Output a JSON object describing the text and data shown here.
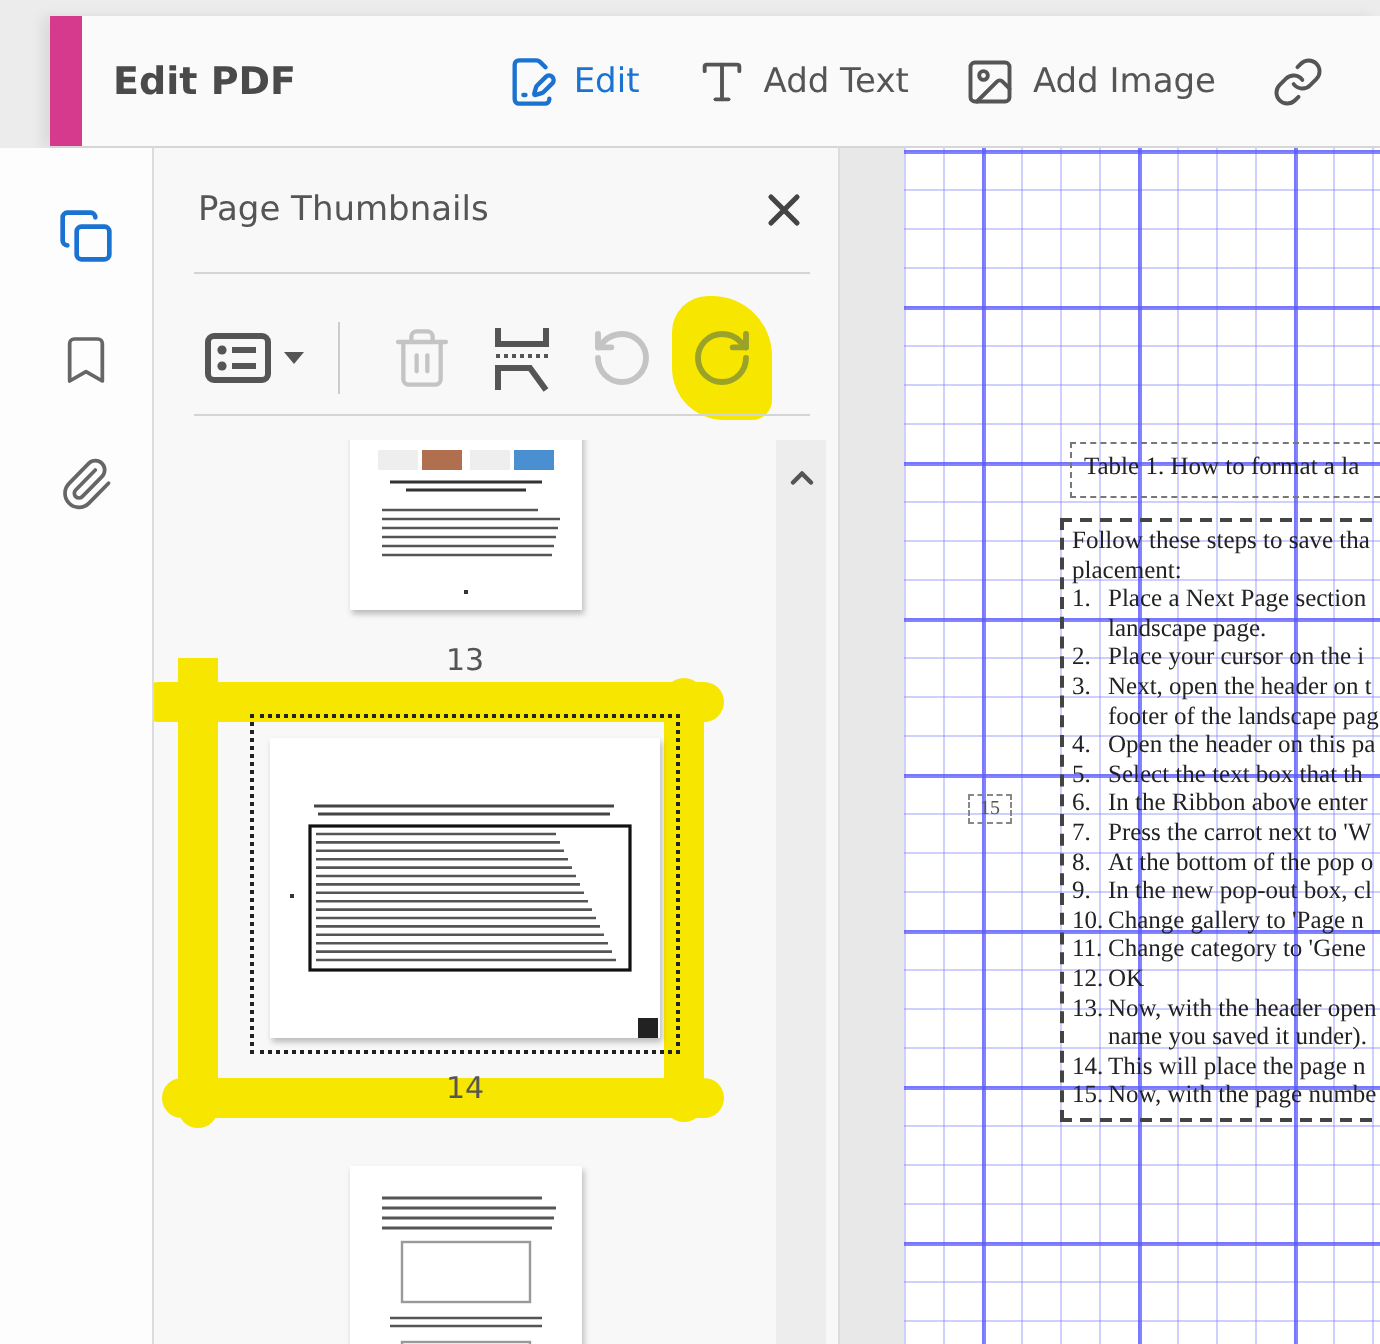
{
  "header": {
    "title": "Edit PDF",
    "tools": [
      {
        "kind": "edit",
        "label": "Edit",
        "selected": true
      },
      {
        "kind": "text",
        "label": "Add Text",
        "selected": false
      },
      {
        "kind": "image",
        "label": "Add Image",
        "selected": false
      },
      {
        "kind": "link",
        "selected": false
      }
    ]
  },
  "nav_rail": [
    {
      "kind": "pages",
      "selected": true
    },
    {
      "kind": "bookmarks",
      "selected": false
    },
    {
      "kind": "attachments",
      "selected": false
    }
  ],
  "panel": {
    "title": "Page Thumbnails",
    "toolbar": [
      {
        "kind": "options",
        "disabled": false,
        "highlighted": false
      },
      {
        "kind": "delete",
        "disabled": true,
        "highlighted": false
      },
      {
        "kind": "insert",
        "disabled": false,
        "highlighted": false
      },
      {
        "kind": "rotate_ccw",
        "disabled": true,
        "highlighted": false
      },
      {
        "kind": "rotate_cw",
        "disabled": false,
        "highlighted": true
      }
    ],
    "thumbnails": [
      {
        "label": "13",
        "kind": "portrait",
        "selected": false,
        "highlighted": false
      },
      {
        "label": "14",
        "kind": "landscape",
        "selected": true,
        "highlighted": true
      },
      {
        "kind": "portrait",
        "selected": false,
        "highlighted": false
      }
    ]
  },
  "document": {
    "page_number": "15",
    "caption": "Table 1. How to format a la",
    "intro": [
      "Follow these steps to save tha",
      "placement:"
    ],
    "steps": [
      {
        "number": "1.",
        "lines": [
          "Place a Next Page section",
          "landscape page."
        ]
      },
      {
        "number": "2.",
        "lines": [
          "Place your cursor on the i"
        ]
      },
      {
        "number": "3.",
        "lines": [
          "Next, open the header on t",
          "footer of the landscape pag"
        ]
      },
      {
        "number": "4.",
        "lines": [
          "Open the header on this pa"
        ]
      },
      {
        "number": "5.",
        "lines": [
          "Select the text box that th"
        ]
      },
      {
        "number": "6.",
        "lines": [
          "In the Ribbon above enter"
        ]
      },
      {
        "number": "7.",
        "lines": [
          "Press the carrot next to 'W"
        ]
      },
      {
        "number": "8.",
        "lines": [
          "At the bottom of the pop o"
        ]
      },
      {
        "number": "9.",
        "lines": [
          "In the new pop-out box, cl"
        ]
      },
      {
        "number": "10.",
        "lines": [
          "Change gallery to 'Page n"
        ]
      },
      {
        "number": "11.",
        "lines": [
          "Change category to 'Gene"
        ]
      },
      {
        "number": "12.",
        "lines": [
          "OK"
        ]
      },
      {
        "number": "13.",
        "lines": [
          "Now, with the header open",
          "name you saved it under)."
        ]
      },
      {
        "number": "14.",
        "lines": [
          "This will place the page n"
        ]
      },
      {
        "number": "15.",
        "lines": [
          "Now, with the page numbe"
        ]
      }
    ]
  }
}
